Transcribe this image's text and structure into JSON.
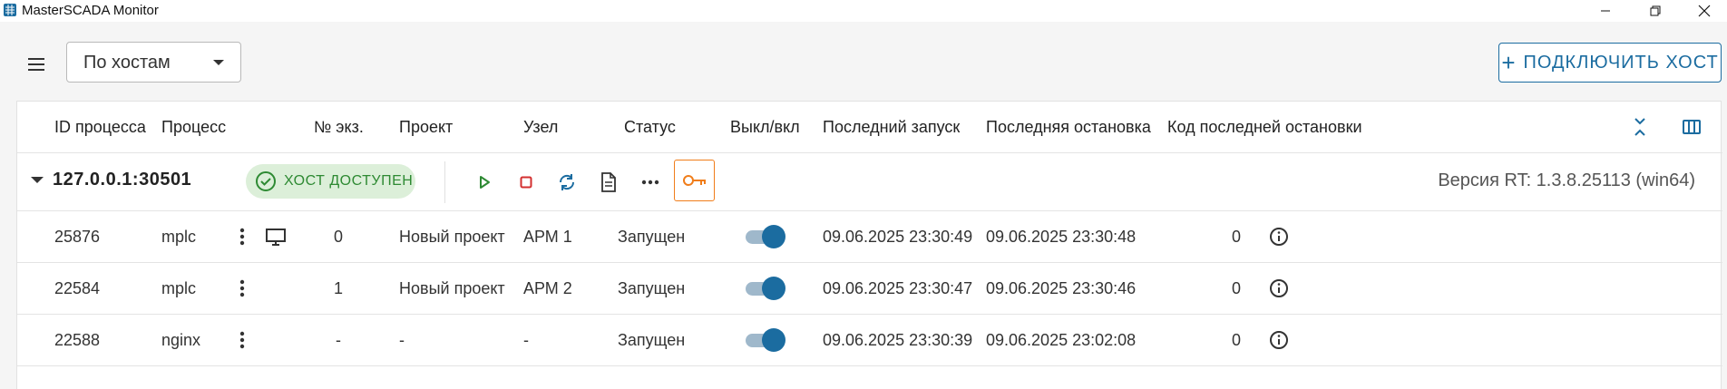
{
  "window": {
    "title": "MasterSCADA Monitor",
    "controls": [
      "minimize",
      "restore",
      "close"
    ]
  },
  "toolbar": {
    "menu_icon": "hamburger-menu-icon",
    "group_select": {
      "value": "По хостам"
    },
    "connect_button": {
      "plus": "+",
      "label": "ПОДКЛЮЧИТЬ ХОСТ"
    }
  },
  "table": {
    "headers": {
      "pid": "ID процесса",
      "process": "Процесс",
      "instance": "№ экз.",
      "project": "Проект",
      "node": "Узел",
      "status": "Статус",
      "toggle": "Выкл/вкл",
      "last_start": "Последний запуск",
      "last_stop": "Последняя остановка",
      "stop_code": "Код последней остановки"
    },
    "header_icons": [
      "collapse-all-icon",
      "columns-icon"
    ],
    "host": {
      "address": "127.0.0.1:30501",
      "status_badge": "ХОСТ ДОСТУПЕН",
      "actions": [
        "play-icon",
        "stop-icon",
        "restart-icon",
        "document-icon",
        "more-icon",
        "key-icon"
      ],
      "rt_version": "Версия RT: 1.3.8.25113 (win64)"
    },
    "rows": [
      {
        "pid": "25876",
        "process": "mplc",
        "has_monitor": true,
        "instance": "0",
        "project": "Новый проект",
        "node": "АРМ 1",
        "status": "Запущен",
        "enabled": true,
        "last_start": "09.06.2025 23:30:49",
        "last_stop": "09.06.2025 23:30:48",
        "stop_code": "0"
      },
      {
        "pid": "22584",
        "process": "mplc",
        "has_monitor": false,
        "instance": "1",
        "project": "Новый проект",
        "node": "АРМ 2",
        "status": "Запущен",
        "enabled": true,
        "last_start": "09.06.2025 23:30:47",
        "last_stop": "09.06.2025 23:30:46",
        "stop_code": "0"
      },
      {
        "pid": "22588",
        "process": "nginx",
        "has_monitor": false,
        "instance": "-",
        "project": "-",
        "node": "-",
        "status": "Запущен",
        "enabled": true,
        "last_start": "09.06.2025 23:30:39",
        "last_stop": "09.06.2025 23:02:08",
        "stop_code": "0"
      }
    ]
  },
  "colors": {
    "accent": "#1b6ca0",
    "success_bg": "#dcefd9",
    "success_text": "#2e8a33",
    "play": "#2e8a33",
    "stop": "#d32f2f",
    "key": "#f07d1a"
  }
}
